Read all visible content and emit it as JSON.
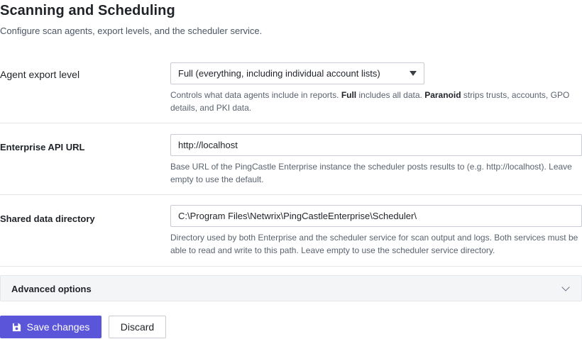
{
  "header": {
    "title": "Scanning and Scheduling",
    "subtitle": "Configure scan agents, export levels, and the scheduler service."
  },
  "agent_export": {
    "label": "Agent export level",
    "selected": "Full (everything, including individual account lists)",
    "help_prefix": "Controls what data agents include in reports. ",
    "help_full": "Full",
    "help_mid": " includes all data. ",
    "help_paranoid": "Paranoid",
    "help_suffix": " strips trusts, accounts, GPO details, and PKI data."
  },
  "enterprise_api": {
    "label": "Enterprise API URL",
    "value": "http://localhost",
    "help": "Base URL of the PingCastle Enterprise instance the scheduler posts results to (e.g. http://localhost). Leave empty to use the default."
  },
  "shared_dir": {
    "label": "Shared data directory",
    "value": "C:\\Program Files\\Netwrix\\PingCastleEnterprise\\Scheduler\\",
    "help": "Directory used by both Enterprise and the scheduler service for scan output and logs. Both services must be able to read and write to this path. Leave empty to use the scheduler service directory."
  },
  "advanced": {
    "label": "Advanced options",
    "icon": "chevron-down-icon"
  },
  "actions": {
    "save_label": "Save changes",
    "save_icon": "floppy-disk-icon",
    "discard_label": "Discard"
  },
  "colors": {
    "primary": "#5a55d9",
    "border": "#e4e6ea",
    "muted_text": "#5b6370"
  }
}
